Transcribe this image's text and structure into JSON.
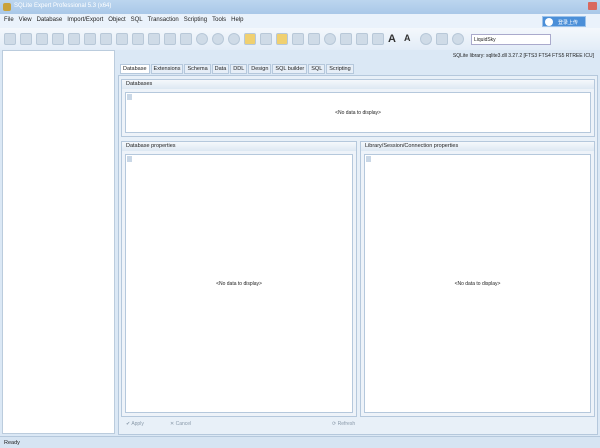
{
  "window": {
    "title": "SQLite Expert Professional 5.3 (x64)",
    "login_label": "登录上传"
  },
  "menu": [
    "File",
    "View",
    "Database",
    "Import/Export",
    "Object",
    "SQL",
    "Transaction",
    "Scripting",
    "Tools",
    "Help"
  ],
  "toolbar": {
    "font_increase": "A",
    "font_decrease": "A",
    "skin_select": "LiquidSky"
  },
  "info": {
    "sqlite_library": "SQLite library: sqlite3.dll 3.27.2 [FTS3 FTS4 FTS5 RTREE ICU]"
  },
  "tabs": [
    "Database",
    "Extensions",
    "Schema",
    "Data",
    "DDL",
    "Design",
    "SQL builder",
    "SQL",
    "Scripting"
  ],
  "panels": {
    "databases": "Databases",
    "db_props": "Database properties",
    "lib_props": "Library/Session/Connection properties",
    "empty": "<No data to display>"
  },
  "buttons": {
    "apply": "Apply",
    "cancel": "Cancel",
    "refresh": "Refresh"
  },
  "status": {
    "text": "Ready"
  }
}
